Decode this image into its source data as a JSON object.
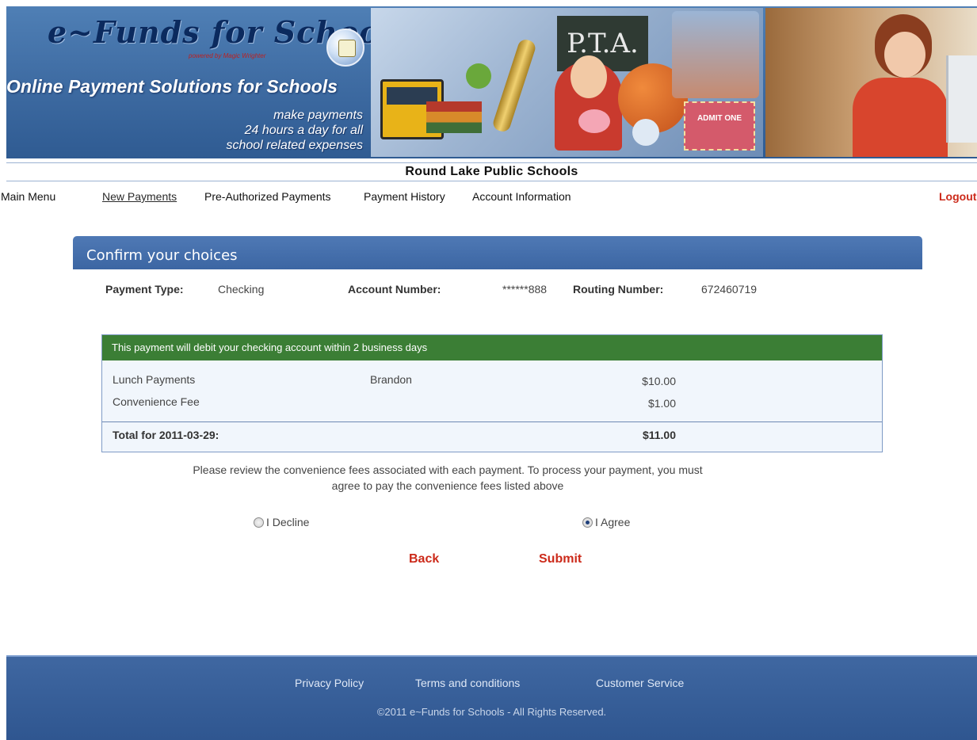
{
  "banner": {
    "brand": "e~Funds for Schools",
    "powered_by": "powered by Magic Wrighter",
    "tagline": "Online Payment Solutions for Schools",
    "slogan_line1": "make payments",
    "slogan_line2": "24 hours a day for all",
    "slogan_line3": "school related expenses",
    "board_text": "P.T.A.",
    "ticket_text": "ADMIT ONE"
  },
  "school_name": "Round Lake Public Schools",
  "nav": {
    "main_menu": "Main Menu",
    "new_payments": "New Payments",
    "pre_authorized": "Pre-Authorized Payments",
    "payment_history": "Payment History",
    "account_information": "Account Information",
    "logout": "Logout"
  },
  "confirm": {
    "title": "Confirm your choices",
    "payment_type_label": "Payment Type:",
    "payment_type_value": "Checking",
    "account_number_label": "Account Number:",
    "account_number_value": "******888",
    "routing_number_label": "Routing Number:",
    "routing_number_value": "672460719"
  },
  "summary": {
    "header": "This payment will debit your checking account within 2 business days",
    "rows": [
      {
        "item": "Lunch Payments",
        "student": "Brandon",
        "amount": "$10.00"
      },
      {
        "item": "Convenience Fee",
        "student": "",
        "amount": "$1.00"
      }
    ],
    "total_label": "Total for 2011-03-29:",
    "total_amount": "$11.00"
  },
  "notice": {
    "line1": "Please review the convenience fees associated with each payment. To process your payment, you must",
    "line2": "agree to pay the convenience fees listed above"
  },
  "choices": {
    "decline_label": "I Decline",
    "agree_label": "I Agree",
    "selected": "agree"
  },
  "actions": {
    "back": "Back",
    "submit": "Submit"
  },
  "footer": {
    "privacy": "Privacy Policy",
    "terms": "Terms and conditions",
    "customer_service": "Customer Service",
    "copyright": "©2011 e~Funds for Schools - All Rights Reserved."
  },
  "colors": {
    "header_blue": "#3d6aa1",
    "summary_green": "#3b7e35",
    "action_red": "#cc2a1a"
  }
}
